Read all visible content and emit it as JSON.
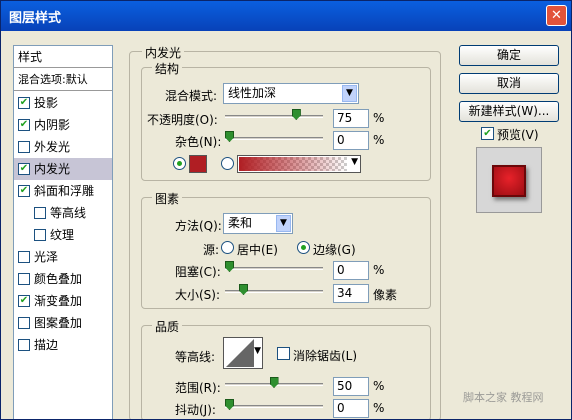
{
  "window": {
    "title": "图层样式",
    "close_glyph": "✕"
  },
  "left_panel": {
    "header": "样式",
    "blend_options": "混合选项:默认",
    "items": [
      {
        "label": "投影",
        "checked": true
      },
      {
        "label": "内阴影",
        "checked": true
      },
      {
        "label": "外发光",
        "checked": false
      },
      {
        "label": "内发光",
        "checked": true,
        "selected": true
      },
      {
        "label": "斜面和浮雕",
        "checked": true
      },
      {
        "label": "等高线",
        "checked": false,
        "indent": true
      },
      {
        "label": "纹理",
        "checked": false,
        "indent": true
      },
      {
        "label": "光泽",
        "checked": false
      },
      {
        "label": "颜色叠加",
        "checked": false
      },
      {
        "label": "渐变叠加",
        "checked": true
      },
      {
        "label": "图案叠加",
        "checked": false
      },
      {
        "label": "描边",
        "checked": false
      }
    ]
  },
  "inner_glow": {
    "title": "内发光",
    "structure": {
      "title": "结构",
      "blend_mode_label": "混合模式:",
      "blend_mode_value": "线性加深",
      "opacity_label": "不透明度(O):",
      "opacity_value": "75",
      "noise_label": "杂色(N):",
      "noise_value": "0",
      "percent": "%",
      "color_hex": "#B01E23"
    },
    "elements": {
      "title": "图素",
      "method_label": "方法(Q):",
      "method_value": "柔和",
      "source_label": "源:",
      "source_center": "居中(E)",
      "source_edge": "边缘(G)",
      "choke_label": "阻塞(C):",
      "choke_value": "0",
      "size_label": "大小(S):",
      "size_value": "34",
      "size_unit": "像素",
      "percent": "%"
    },
    "quality": {
      "title": "品质",
      "contour_label": "等高线:",
      "antialias_label": "消除锯齿(L)",
      "range_label": "范围(R):",
      "range_value": "50",
      "jitter_label": "抖动(J):",
      "jitter_value": "0",
      "percent": "%"
    }
  },
  "buttons": {
    "ok": "确定",
    "cancel": "取消",
    "new_style": "新建样式(W)...",
    "preview_label": "预览(V)"
  },
  "watermark": "脚本之家 教程网"
}
